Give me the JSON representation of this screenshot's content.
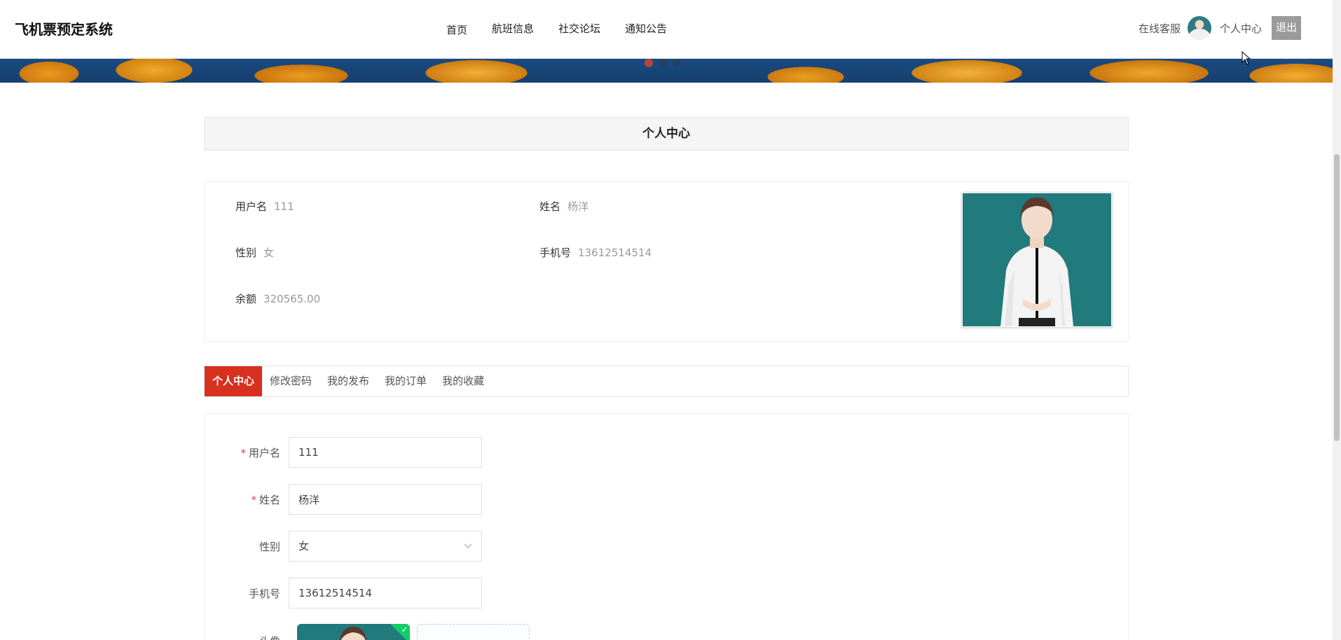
{
  "header": {
    "logo": "飞机票预定系统",
    "nav": [
      "首页",
      "航班信息",
      "社交论坛",
      "通知公告"
    ],
    "online_service": "在线客服",
    "user_center": "个人中心",
    "logout": "退出"
  },
  "banner": {
    "dots": 3,
    "active_dot": 1
  },
  "page_title": "个人中心",
  "profile": {
    "username_label": "用户名",
    "username": "111",
    "name_label": "姓名",
    "name": "杨洋",
    "gender_label": "性别",
    "gender": "女",
    "phone_label": "手机号",
    "phone": "13612514514",
    "balance_label": "余额",
    "balance": "320565.00"
  },
  "tabs": [
    {
      "label": "个人中心",
      "active": true
    },
    {
      "label": "修改密码",
      "active": false
    },
    {
      "label": "我的发布",
      "active": false
    },
    {
      "label": "我的订单",
      "active": false
    },
    {
      "label": "我的收藏",
      "active": false
    }
  ],
  "form": {
    "username_label": "用户名",
    "username_value": "111",
    "name_label": "姓名",
    "name_value": "杨洋",
    "gender_label": "性别",
    "gender_value": "女",
    "phone_label": "手机号",
    "phone_value": "13612514514",
    "avatar_label": "头像",
    "required_mark": "*"
  },
  "colors": {
    "accent_red": "#d7301f",
    "photo_bg": "#2c7c80",
    "upload_success": "#13ce66"
  }
}
